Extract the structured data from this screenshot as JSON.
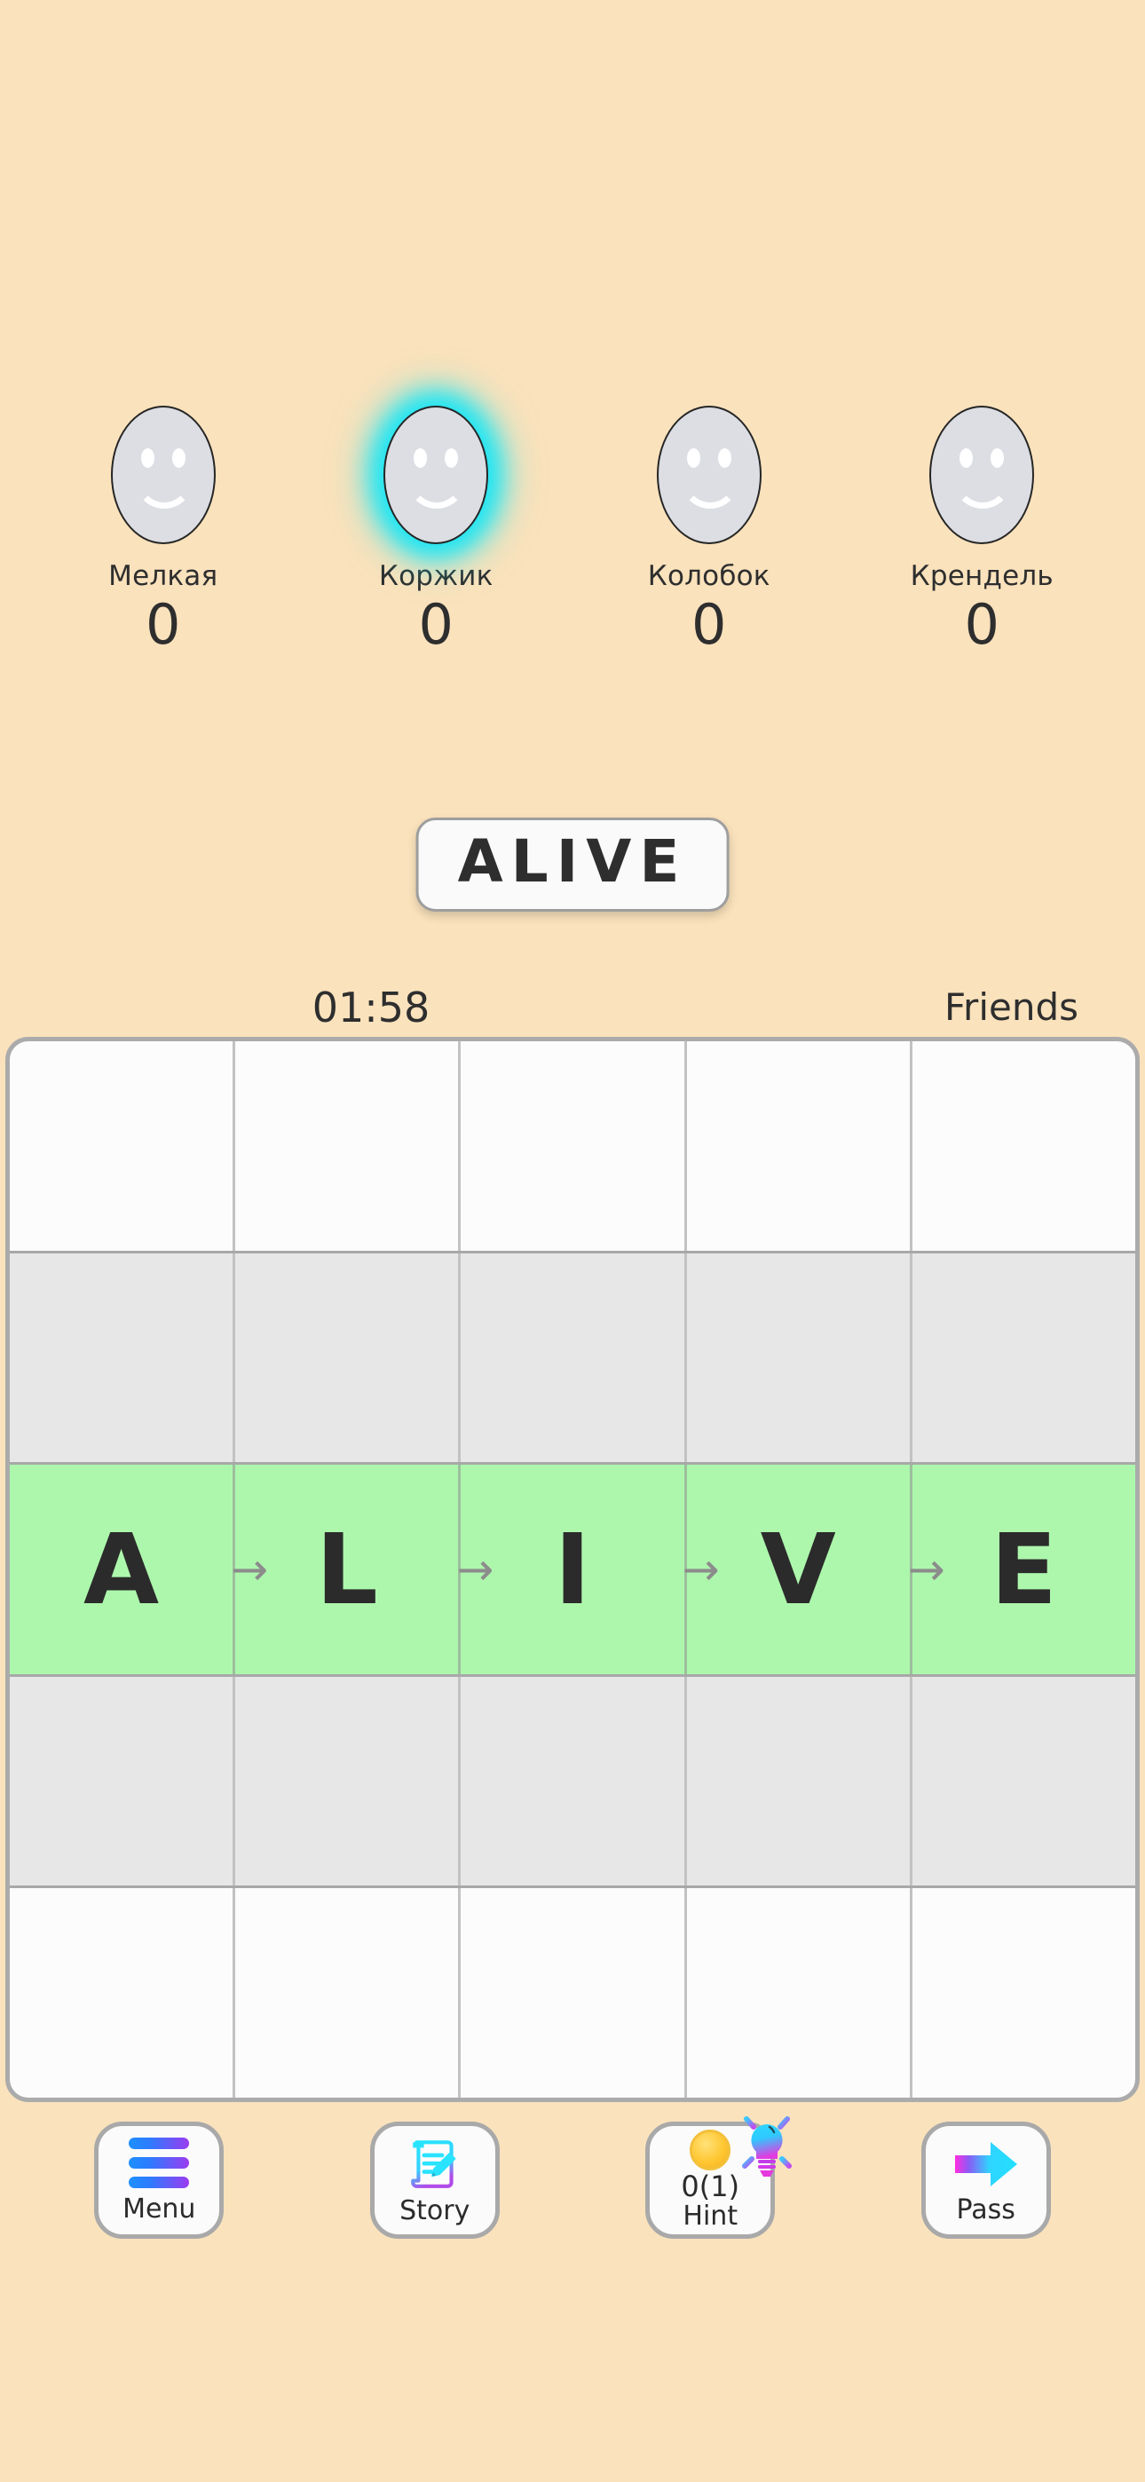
{
  "theme": {
    "background": "#FAE2BC",
    "accent_glow": "#18E6F5",
    "active_row": "#ADF7AD",
    "text": "#2E2E2E",
    "card_bg": "#FAFAFA",
    "border": "#A9A9A9"
  },
  "players": [
    {
      "name": "Мелкая",
      "score": "0",
      "active": false,
      "avatar": "smiley-face-avatar"
    },
    {
      "name": "Коржик",
      "score": "0",
      "active": true,
      "avatar": "smiley-face-avatar"
    },
    {
      "name": "Колобок",
      "score": "0",
      "active": false,
      "avatar": "smiley-face-avatar"
    },
    {
      "name": "Крендель",
      "score": "0",
      "active": false,
      "avatar": "smiley-face-avatar"
    }
  ],
  "word_card": {
    "word": "ALIVE"
  },
  "status": {
    "timer": "01:58",
    "mode": "Friends"
  },
  "board": {
    "rows": 5,
    "cols": 5,
    "active_row_index": 2,
    "letters": [
      "A",
      "L",
      "I",
      "V",
      "E"
    ],
    "arrow_glyph": "→",
    "row_styles": [
      "plain",
      "shade",
      "active",
      "shade",
      "plain"
    ]
  },
  "toolbar": {
    "menu": {
      "label": "Menu",
      "icon": "hamburger-menu-icon"
    },
    "story": {
      "label": "Story",
      "icon": "document-pencil-icon"
    },
    "hint": {
      "label": "Hint",
      "count": "0(1)",
      "icon": "lightbulb-icon",
      "coin_icon": "coin-icon"
    },
    "pass": {
      "label": "Pass",
      "icon": "arrow-right-icon"
    }
  }
}
